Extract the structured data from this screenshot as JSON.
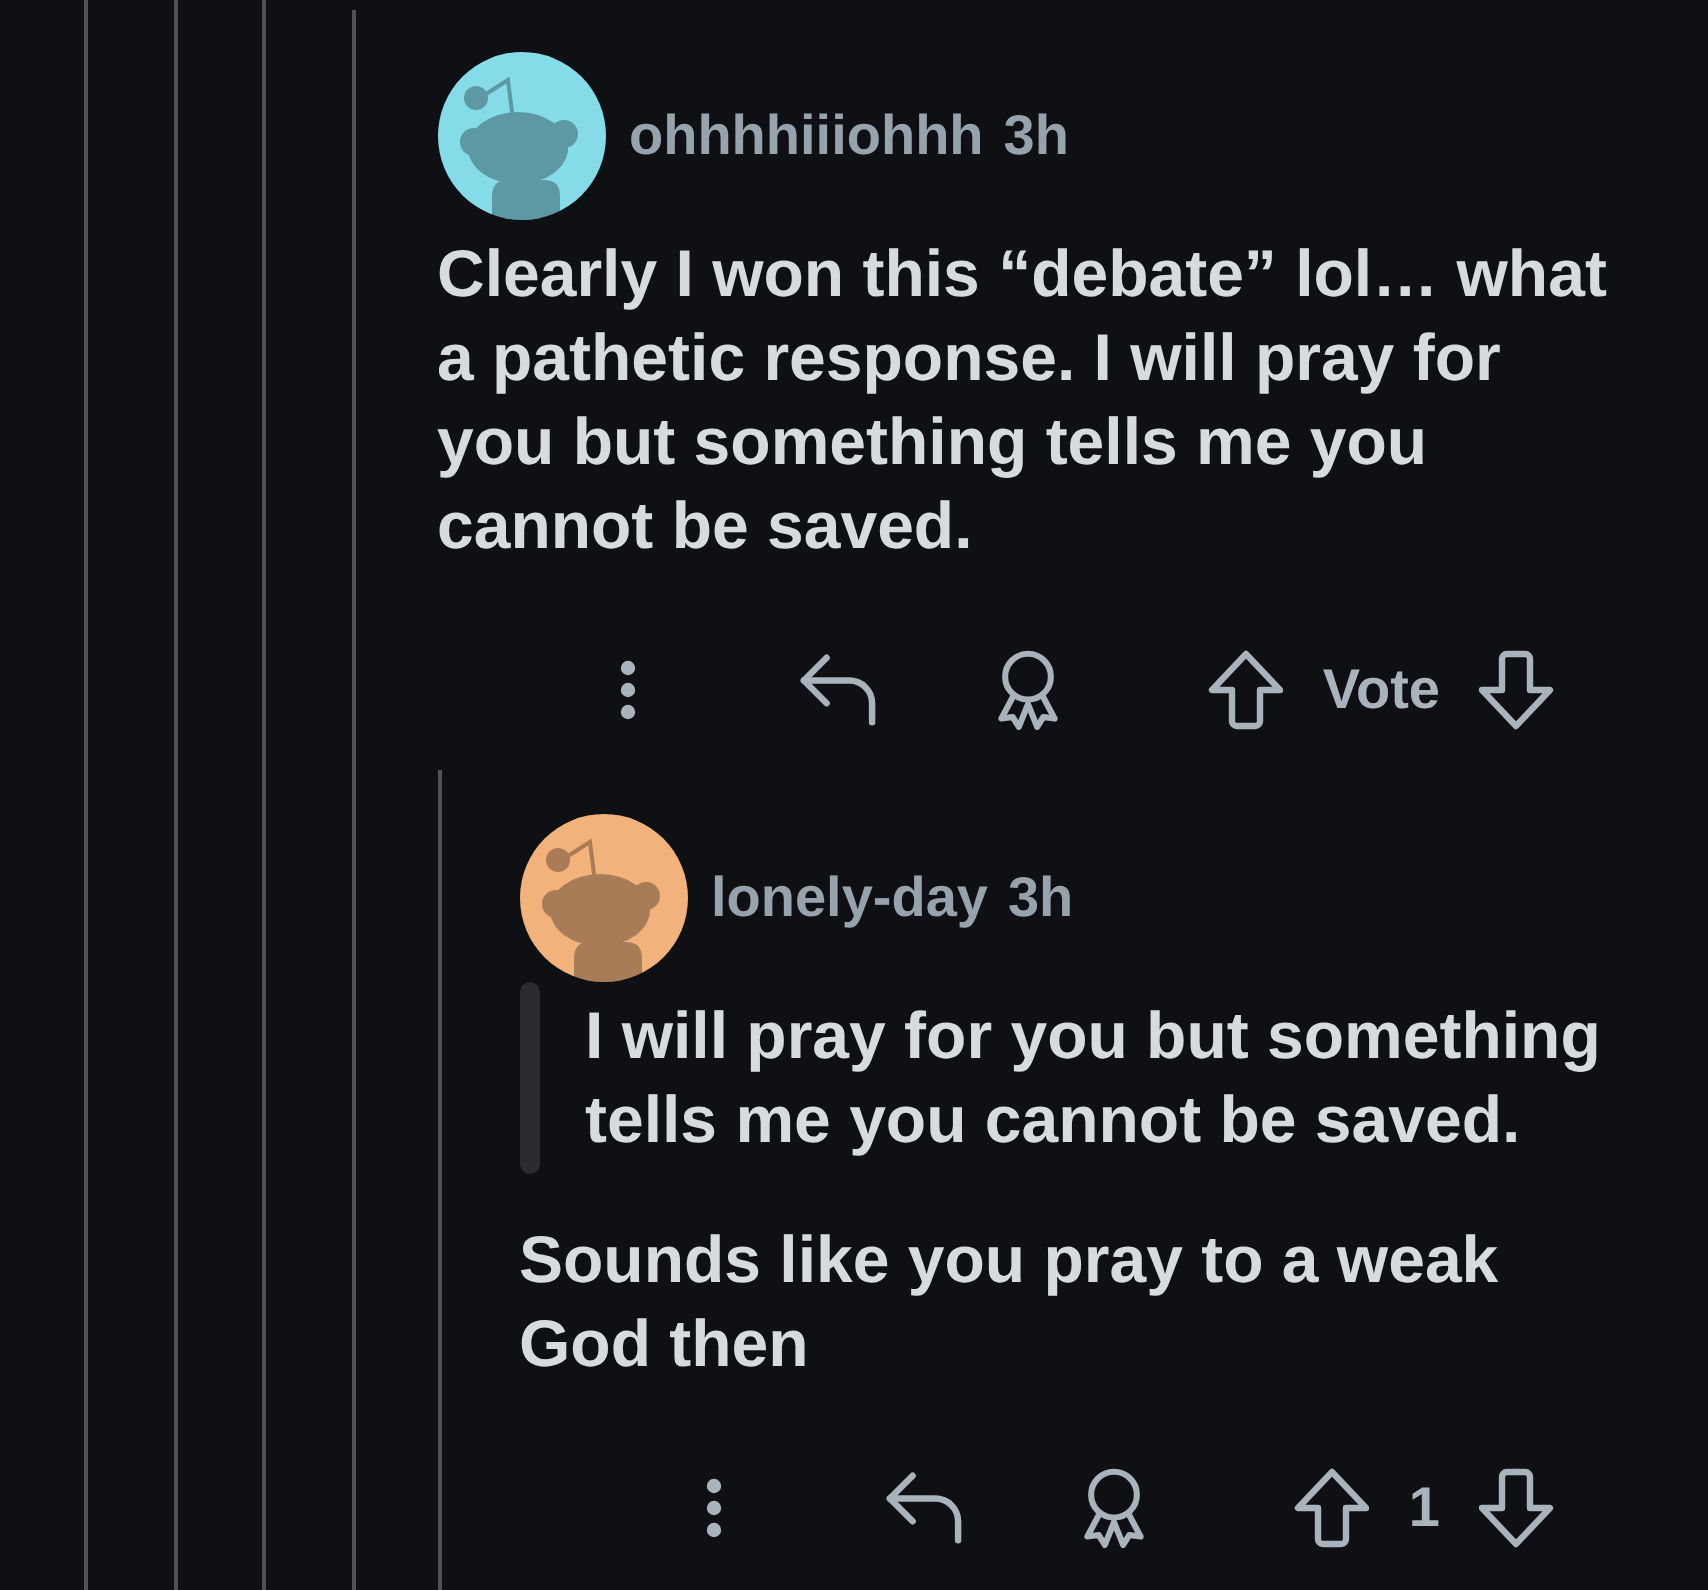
{
  "comments": [
    {
      "author": "ohhhhiiiohhh",
      "time": "3h",
      "avatar": {
        "color": "#86dbe9"
      },
      "body": "Clearly I won this “debate” lol… what a pathetic response. I will pray for you but something tells me you cannot be saved.",
      "score": "Vote",
      "replies": [
        {
          "author": "lonely-day",
          "time": "3h",
          "avatar": {
            "color": "#f1b27b"
          },
          "quote": "I will pray for you but something tells me you cannot be saved.",
          "body": "Sounds like you pray to a weak God then",
          "score": "1"
        }
      ]
    }
  ]
}
